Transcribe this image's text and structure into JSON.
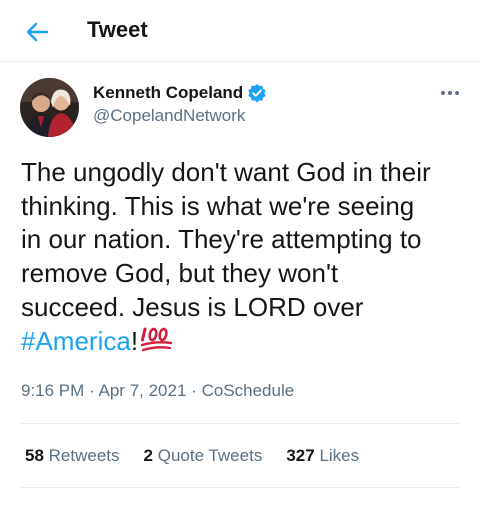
{
  "header": {
    "title": "Tweet",
    "back_icon": "arrow-left-icon",
    "accent": "#1da1f2"
  },
  "tweet": {
    "author": {
      "name": "Kenneth Copeland",
      "handle": "@CopelandNetwork",
      "verified": true
    },
    "lines": [
      "The ungodly don't want God in their",
      "thinking. This is what we're seeing",
      "in our nation. They're attempting to",
      "remove God, but they won't",
      "succeed. Jesus is LORD over"
    ],
    "hashtag": "#America",
    "after_hashtag": "!",
    "emoji": "hundred-points-emoji",
    "time": "9:16 PM",
    "date": "Apr 7, 2021",
    "source": "CoSchedule",
    "dot": "·"
  },
  "stats": {
    "retweets_count": "58",
    "retweets_label": "Retweets",
    "quotes_count": "2",
    "quotes_label": "Quote Tweets",
    "likes_count": "327",
    "likes_label": "Likes"
  }
}
